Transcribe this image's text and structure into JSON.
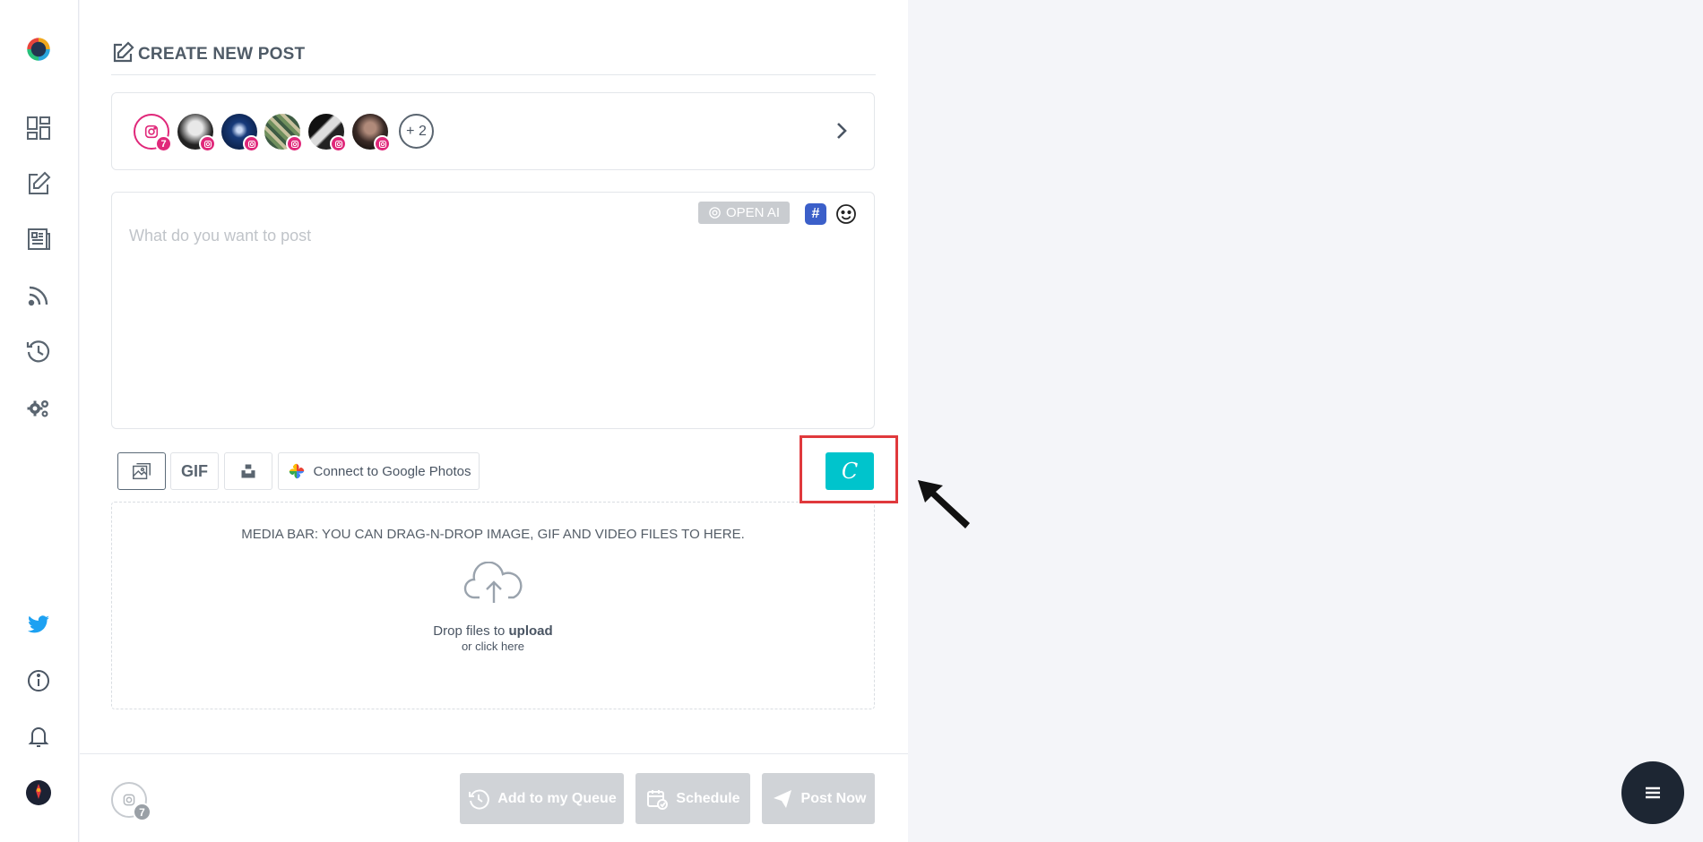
{
  "header": {
    "title": "CREATE NEW POST"
  },
  "accounts": {
    "primary_count": "7",
    "more_label": "+ 2"
  },
  "composer": {
    "placeholder": "What do you want to post",
    "openai_label": "OPEN AI",
    "hashtag_label": "#"
  },
  "media_tools": {
    "gif_label": "GIF",
    "google_photos_label": "Connect to Google Photos",
    "canva_label": "C"
  },
  "dropzone": {
    "note": "MEDIA BAR: YOU CAN DRAG-N-DROP IMAGE, GIF AND VIDEO FILES TO HERE.",
    "drop_prefix": "Drop files to",
    "drop_bold": "upload",
    "drop_sub": "or click here"
  },
  "footer": {
    "account_count": "7",
    "queue_label": "Add to my Queue",
    "schedule_label": "Schedule",
    "post_now_label": "Post Now"
  },
  "colors": {
    "accent_pink": "#e0287a",
    "canva": "#00c4cc",
    "highlight": "#e0393c",
    "twitter": "#1da1f2",
    "fab": "#1d2633"
  }
}
